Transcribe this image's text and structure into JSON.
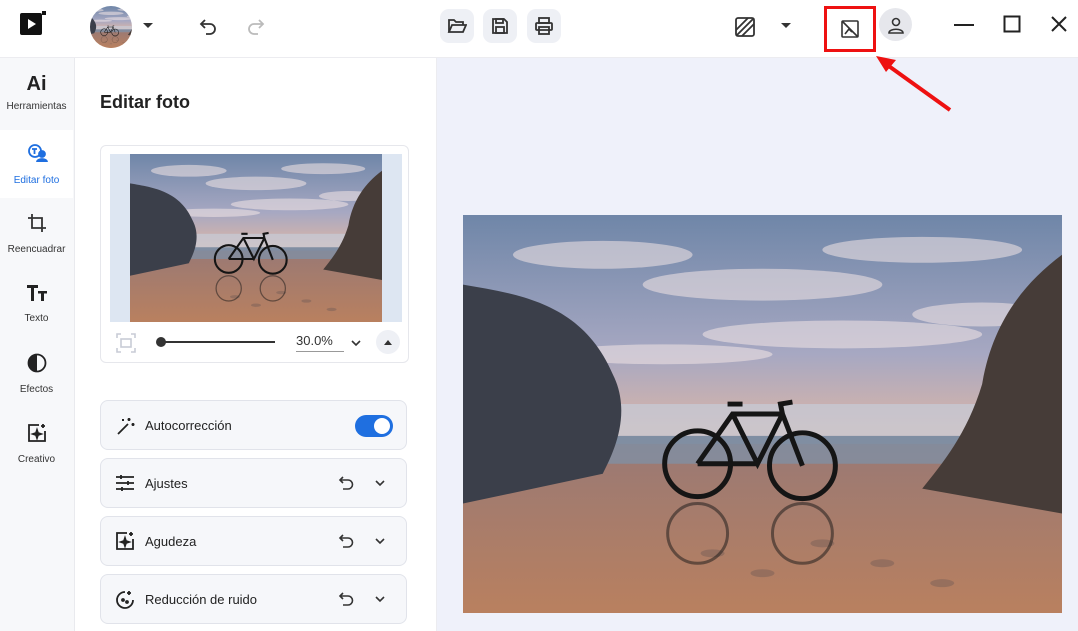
{
  "toolbar": {
    "icons": [
      "app-logo-icon",
      "avatar",
      "chevron-down-icon",
      "undo-icon",
      "redo-icon",
      "folder-open-icon",
      "save-icon",
      "print-icon",
      "compare-icon",
      "hide-preview-icon",
      "user-icon",
      "minimize-icon",
      "maximize-icon",
      "close-icon"
    ],
    "highlight_color": "#e11111"
  },
  "rail": {
    "items": [
      {
        "id": "herramientas",
        "label": "Herramientas",
        "icon_text": "Ai",
        "active": false
      },
      {
        "id": "editar-foto",
        "label": "Editar foto",
        "icon": "edit-photo-icon",
        "active": true
      },
      {
        "id": "reencuadrar",
        "label": "Reencuadrar",
        "icon": "crop-icon",
        "active": false
      },
      {
        "id": "texto",
        "label": "Texto",
        "icon": "text-icon",
        "active": false
      },
      {
        "id": "efectos",
        "label": "Efectos",
        "icon": "effects-icon",
        "active": false
      },
      {
        "id": "creativo",
        "label": "Creativo",
        "icon": "creative-icon",
        "active": false
      }
    ]
  },
  "panel": {
    "title": "Editar foto",
    "zoom": {
      "value": "30.0%",
      "slider_fraction": 0.05
    },
    "tools": [
      {
        "label": "Autocorrección",
        "icon": "magic-wand-icon",
        "toggle": true
      },
      {
        "label": "Ajustes",
        "icon": "sliders-icon"
      },
      {
        "label": "Agudeza",
        "icon": "sharpen-icon"
      },
      {
        "label": "Reducción de ruido",
        "icon": "denoise-icon"
      }
    ]
  },
  "colors": {
    "accent": "#1f6fe0",
    "canvas_bg": "#eff1fa",
    "annotation": "#e11111"
  }
}
